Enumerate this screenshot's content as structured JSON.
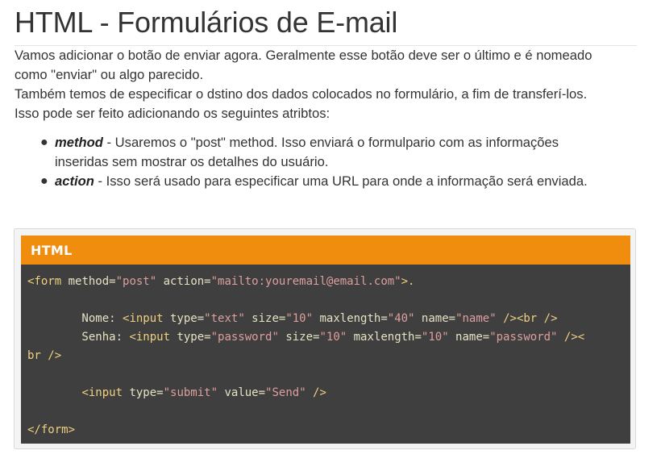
{
  "article": {
    "title": "HTML - Formulários de E-mail",
    "paragraph1_line1": "Vamos adicionar o botão de enviar agora. Geralmente esse botão deve ser o último e é nomeado",
    "paragraph1_line2": "como \"enviar\" ou algo parecido.",
    "paragraph2_line1": "Também temos de especificar o dstino dos dados colocados no formulário, a fim de transferí-los.",
    "paragraph2_line2": "Isso pode ser feito adicionando os seguintes atribtos:",
    "list": [
      {
        "term": "method",
        "text_line1": " - Usaremos o \"post\" method. Isso enviará o formulpario com as informações",
        "text_line2": "inseridas sem mostrar os detalhes do usuário."
      },
      {
        "term": "action",
        "text_line1": " - Isso será usado para especificar uma URL para onde a informação será enviada."
      }
    ]
  },
  "code_example": {
    "header": "HTML",
    "lines": {
      "l1_open": "<form",
      "l1_a1": " method=",
      "l1_v1": "\"post\"",
      "l1_a2": " action=",
      "l1_v2": "\"mailto:youremail@email.com\"",
      "l1_close": ">.",
      "l3_label": "        Nome: ",
      "l3_open": "<input",
      "l3_a1": " type=",
      "l3_v1": "\"text\"",
      "l3_a2": " size=",
      "l3_v2": "\"10\"",
      "l3_a3": " maxlength=",
      "l3_v3": "\"40\"",
      "l3_a4": " name=",
      "l3_v4": "\"name\"",
      "l3_close": " />",
      "l3_br": "<br />",
      "l4_label": "        Senha: ",
      "l4_open": "<input",
      "l4_a1": " type=",
      "l4_v1": "\"password\"",
      "l4_a2": " size=",
      "l4_v2": "\"10\"",
      "l4_a3": " maxlength=",
      "l4_v3": "\"10\"",
      "l4_a4": " name=",
      "l4_v4": "\"password\"",
      "l4_close": " /><",
      "l5_br": "br />",
      "l7_indent": "        ",
      "l7_open": "<input",
      "l7_a1": " type=",
      "l7_v1": "\"submit\"",
      "l7_a2": " value=",
      "l7_v2": "\"Send\"",
      "l7_close": " />",
      "l9_close": "</form>"
    }
  },
  "colors": {
    "header_orange": "#f08c0e",
    "code_bg": "#3f3f3f",
    "tag": "#f0d080",
    "string": "#dd9f9f"
  }
}
